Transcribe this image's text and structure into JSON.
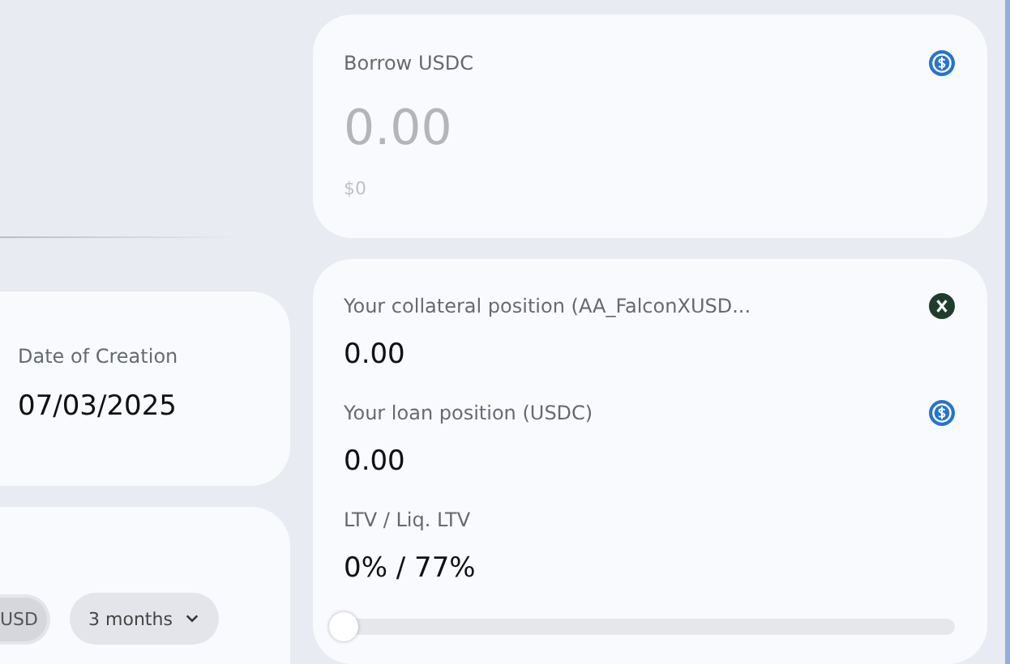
{
  "details_card": {
    "label": "Date of Creation",
    "value": "07/03/2025"
  },
  "chart_controls": {
    "currency_options": [
      {
        "label": "USD",
        "selected": true
      }
    ],
    "period": "3 months"
  },
  "borrow_card": {
    "title": "Borrow USDC",
    "amount_placeholder": "0.00",
    "usd_value": "$0"
  },
  "position_card": {
    "items": [
      {
        "label": "Your collateral position (AA_FalconXUSD...",
        "value": "0.00",
        "kind": "collateral"
      },
      {
        "label": "Your loan position (USDC)",
        "value": "0.00",
        "kind": "loan"
      },
      {
        "label": "LTV / Liq. LTV",
        "value": "0% / 77%",
        "kind": "ratio"
      }
    ],
    "ltv_slider": {
      "level": 0
    }
  }
}
